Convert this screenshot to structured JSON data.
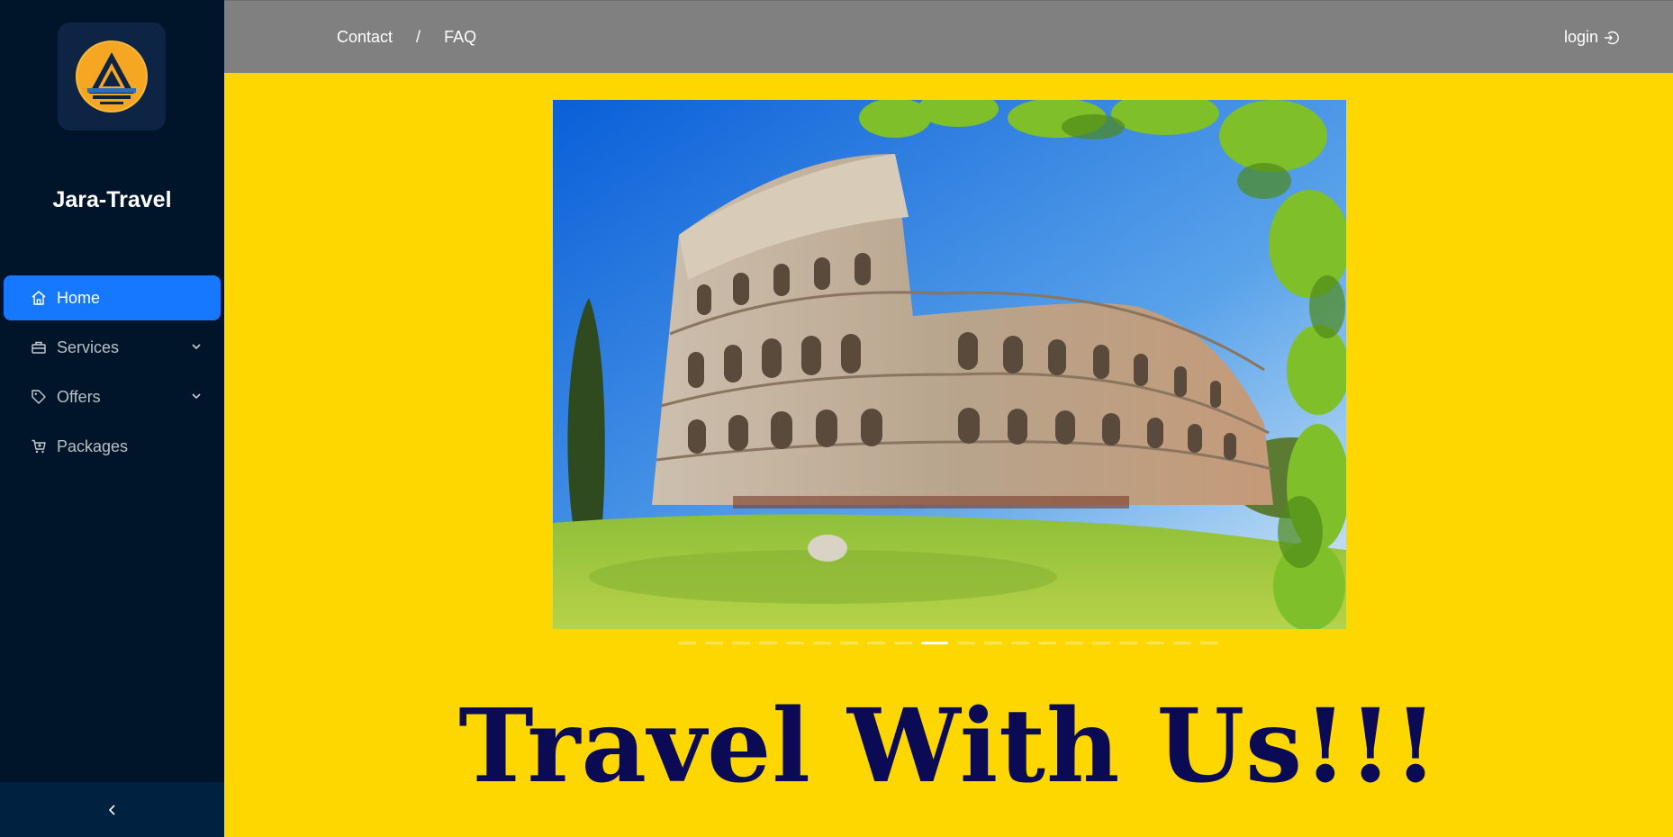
{
  "brand": {
    "name": "Jara-Travel"
  },
  "sidebar": {
    "items": [
      {
        "label": "Home",
        "icon": "home-icon",
        "active": true
      },
      {
        "label": "Services",
        "icon": "briefcase-icon",
        "has_submenu": true
      },
      {
        "label": "Offers",
        "icon": "tag-icon",
        "has_submenu": true
      },
      {
        "label": "Packages",
        "icon": "cart-icon"
      }
    ],
    "collapse_icon": "chevron-left-icon"
  },
  "topbar": {
    "links": [
      "Contact",
      "FAQ"
    ],
    "separator": "/",
    "login_label": "login",
    "login_icon": "login-icon"
  },
  "carousel": {
    "slide_count": 20,
    "active_index": 9,
    "image_subject": "Colosseum, Rome"
  },
  "hero": {
    "headline": "Travel With Us!!!"
  },
  "colors": {
    "sidebar_bg": "#001529",
    "active_item": "#1677ff",
    "topbar_bg": "#808080",
    "main_bg": "#ffd700",
    "headline": "#0b0b55"
  }
}
